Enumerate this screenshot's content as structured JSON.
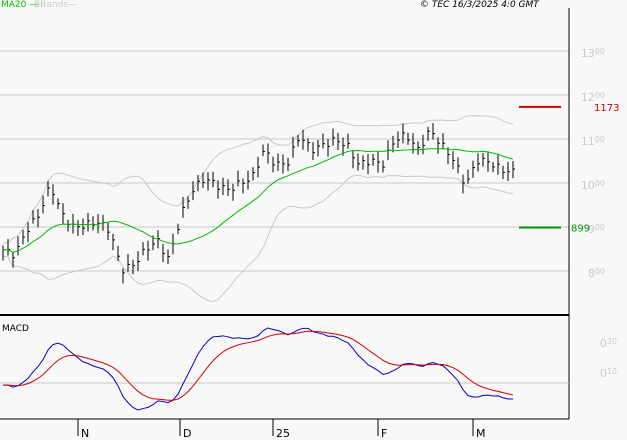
{
  "legend": {
    "ma_label": "MA20",
    "bb_label": "BBands",
    "ma_color": "#00bb00",
    "bb_color": "#c8c8c8"
  },
  "copyright": "© TEC 16/3/2025 4:0 GMT",
  "chart_data": {
    "type": "line",
    "title": "Price bars with MA20, Bollinger Bands and MACD",
    "price_axis": {
      "ylim": [
        760,
        1360
      ],
      "ticks": [
        {
          "main": "13",
          "sup": "00",
          "value": 1300
        },
        {
          "main": "12",
          "sup": "00",
          "value": 1200
        },
        {
          "main": "11",
          "sup": "00",
          "value": 1100
        },
        {
          "main": "10",
          "sup": "00",
          "value": 1000
        },
        {
          "main": "9",
          "sup": "00",
          "value": 900
        },
        {
          "main": "8",
          "sup": "00",
          "value": 800
        }
      ]
    },
    "x_labels": [
      "N",
      "D",
      "25",
      "F",
      "M"
    ],
    "close_keypoints": [
      848,
      836,
      893,
      927,
      995,
      927,
      898,
      905,
      911,
      893,
      802,
      814,
      848,
      870,
      825,
      927,
      984,
      1011,
      995,
      984,
      1000,
      1011,
      1075,
      1041,
      1045,
      1109,
      1075,
      1086,
      1098,
      1086,
      1041,
      1052,
      1041,
      1098,
      1109,
      1075,
      1120,
      1086,
      1052,
      995,
      1052,
      1048,
      1030,
      1025
    ],
    "resistance": {
      "value": 1173,
      "label": "1173",
      "color": "#d00000"
    },
    "support": {
      "value": 899,
      "label": "899",
      "color": "#009000"
    },
    "macd": {
      "label": "MACD",
      "ticks": [
        {
          "main": "0",
          "sup": "30"
        },
        {
          "main": "0",
          "sup": "10"
        }
      ],
      "macd_color": "#0000cc",
      "signal_color": "#cc0000"
    }
  }
}
